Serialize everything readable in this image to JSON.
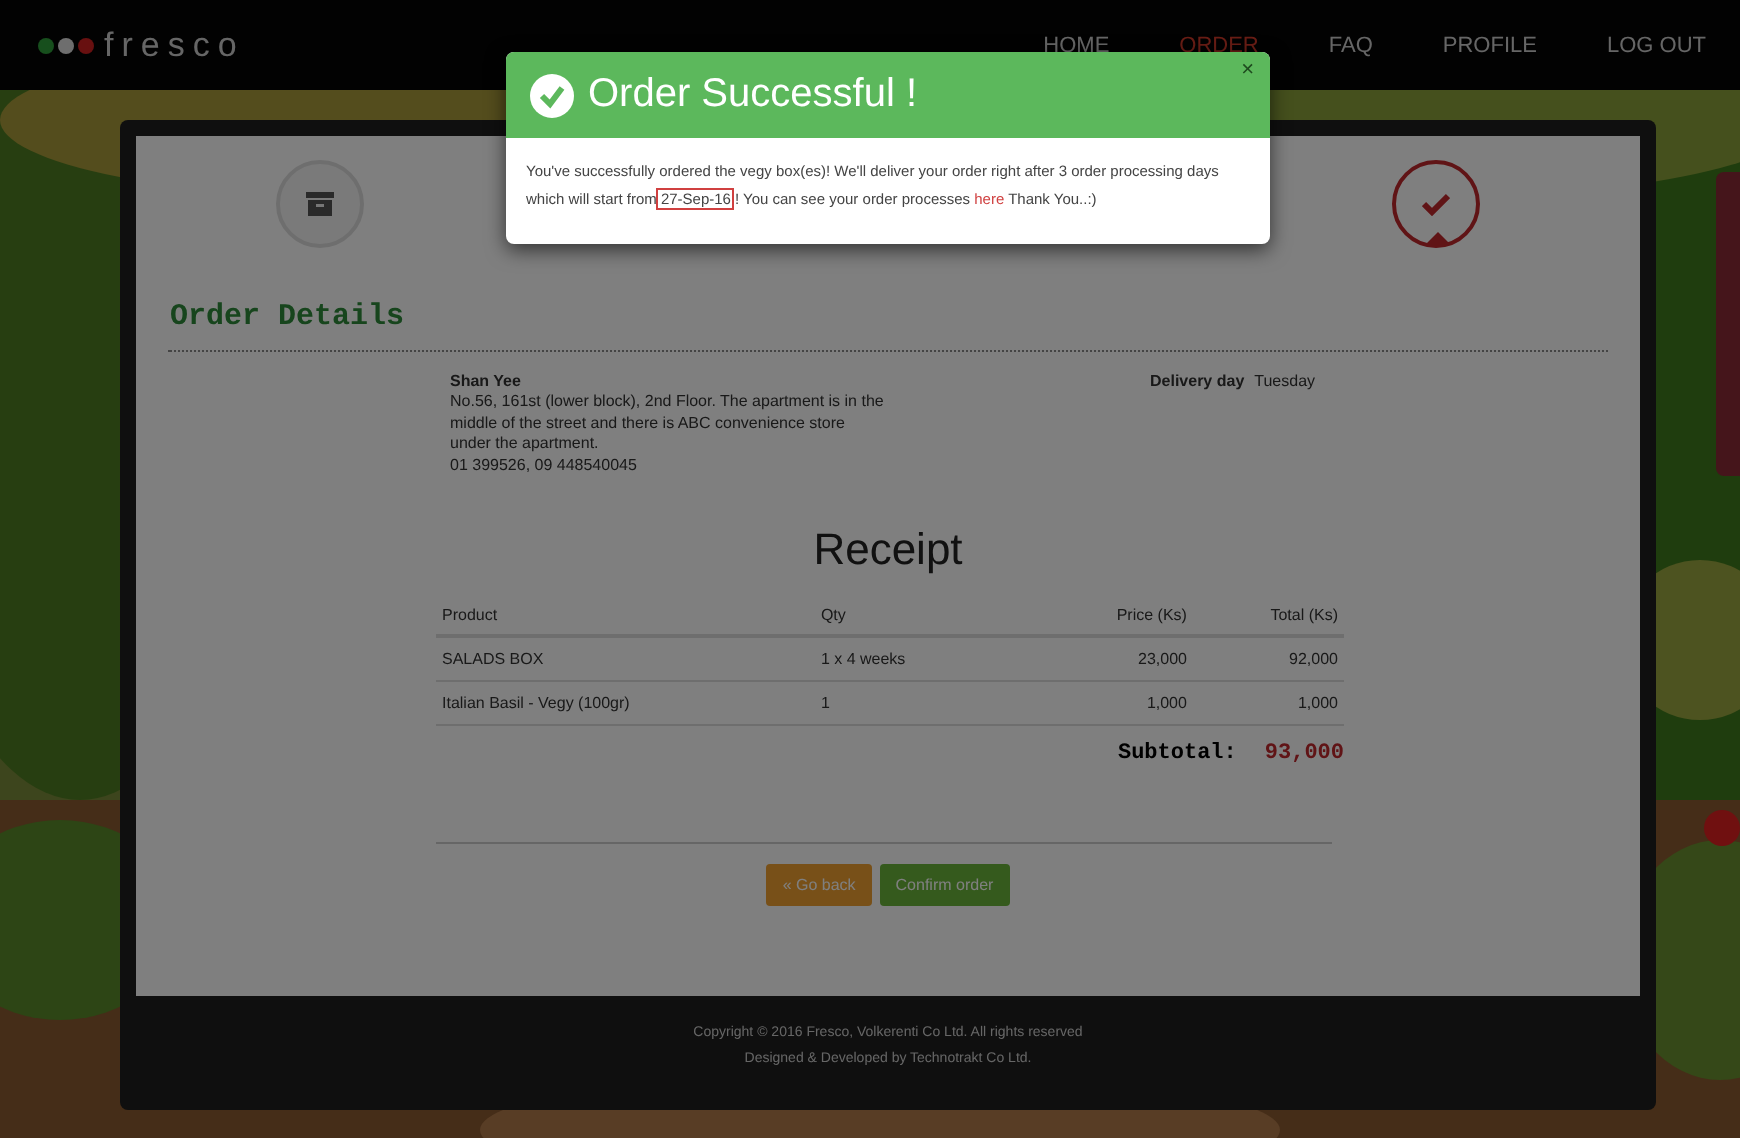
{
  "navbar": {
    "logo": "fresco",
    "items": [
      {
        "label": "HOME",
        "selected": false
      },
      {
        "label": "ORDER",
        "selected": true
      },
      {
        "label": "FAQ",
        "selected": false
      },
      {
        "label": "PROFILE",
        "selected": false
      },
      {
        "label": "LOG OUT",
        "selected": false
      }
    ]
  },
  "steps": [
    {
      "kind": "box",
      "selected": false
    },
    {
      "kind": "check",
      "selected": true
    }
  ],
  "order_details": {
    "title": "Order Details",
    "customer_name": "Shan Yee",
    "address": "No.56, 161st (lower block), 2nd Floor. The apartment is in the middle of the street and there is ABC convenience store under the apartment.",
    "phones": "01 399526, 09 448540045",
    "delivery_label": "Delivery day",
    "delivery_value": "Tuesday"
  },
  "receipt": {
    "title": "Receipt",
    "columns": [
      "Product",
      "Qty",
      "Price (Ks)",
      "Total (Ks)"
    ],
    "rows": [
      [
        "SALADS BOX",
        "1 x 4 weeks",
        "23,000",
        "92,000"
      ],
      [
        "Italian Basil - Vegy (100gr)",
        "1",
        "1,000",
        "1,000"
      ]
    ],
    "subtotal_label": "Subtotal:",
    "subtotal_value": "93,000"
  },
  "buttons": [
    {
      "label": "« Go back",
      "kind": "back"
    },
    {
      "label": "Confirm order",
      "kind": "confirm"
    }
  ],
  "footer": [
    "Copyright © 2016 Fresco, Volkerenti Co Ltd.  All rights reserved",
    "Designed & Developed by Technotrakt Co Ltd."
  ],
  "modal": {
    "title": "Order Successful !",
    "close": "×",
    "text_before": "You've successfully ordered the vegy box(es)! We'll deliver your order right after 3 order processing days which will start from",
    "date": "27-Sep-16",
    "text_middle": "! You can see your order processes",
    "link": "here",
    "text_after": "Thank You..:)"
  }
}
